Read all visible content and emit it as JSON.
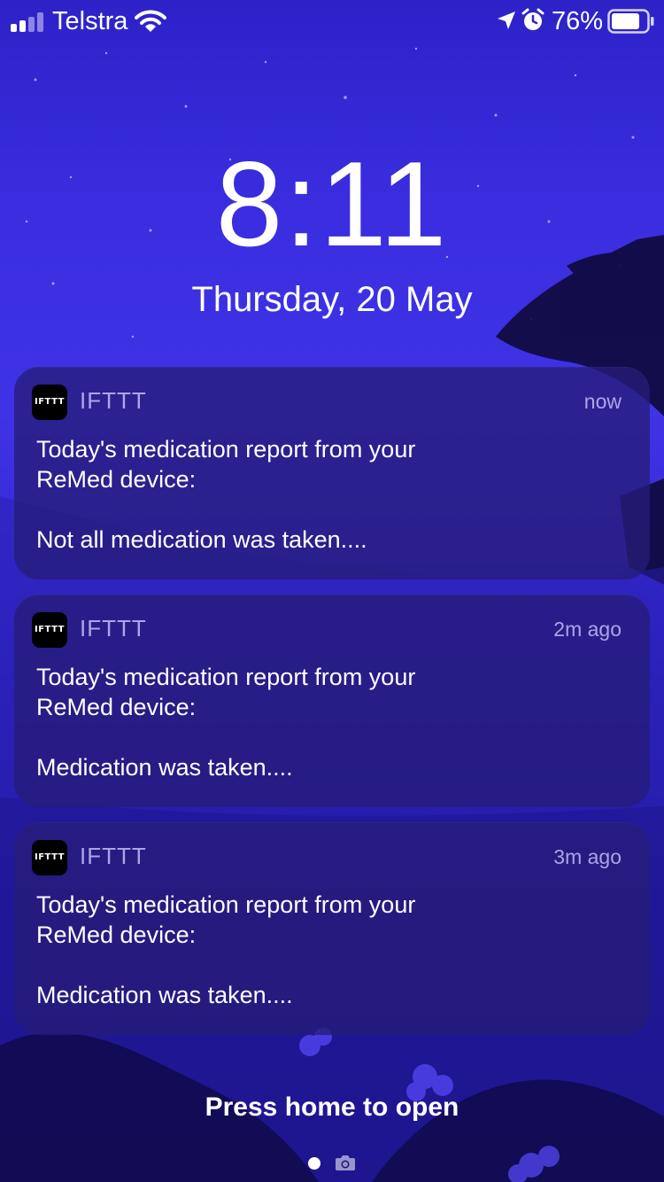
{
  "status_bar": {
    "carrier": "Telstra",
    "battery_percent": "76%",
    "signal_bars_filled": 2,
    "signal_bars_total": 4,
    "icons": [
      "signal-icon",
      "wifi-icon",
      "location-icon",
      "alarm-icon",
      "battery-icon"
    ]
  },
  "lock_screen": {
    "time": "8:11",
    "date": "Thursday, 20 May"
  },
  "notifications": [
    {
      "app": "IFTTT",
      "app_icon_text": "IFTTT",
      "time": "now",
      "line1": "Today's medication report from your",
      "line2": "ReMed device:",
      "line3": "Not all medication was taken...."
    },
    {
      "app": "IFTTT",
      "app_icon_text": "IFTTT",
      "time": "2m ago",
      "line1": "Today's medication report from your",
      "line2": "ReMed device:",
      "line3": "Medication was taken...."
    },
    {
      "app": "IFTTT",
      "app_icon_text": "IFTTT",
      "time": "3m ago",
      "line1": "Today's medication report from your",
      "line2": "ReMed device:",
      "line3": "Medication was taken...."
    }
  ],
  "bottom": {
    "prompt": "Press home to open",
    "icons": [
      "page-dot",
      "camera-icon"
    ]
  },
  "colors": {
    "wallpaper_top": "#2d22c8",
    "wallpaper_bottom": "#150c6e",
    "notification_bg": "#261c78",
    "secondary_text": "#c8c3ff"
  }
}
